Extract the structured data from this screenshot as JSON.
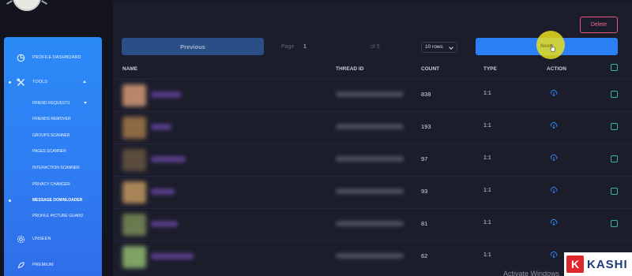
{
  "sidebar": {
    "items": [
      {
        "label": "PROFILE DASHBOARD",
        "icon": "dashboard-pie-icon"
      },
      {
        "label": "TOOLS",
        "icon": "tools-icon"
      },
      {
        "label": "UNSEEN",
        "icon": "gear-icon"
      },
      {
        "label": "PREMIUM",
        "icon": "rocket-icon"
      }
    ],
    "sub_items": [
      {
        "label": "FRIEND REQUESTS"
      },
      {
        "label": "FRIENDS REMOVER"
      },
      {
        "label": "GROUPS SCANNER"
      },
      {
        "label": "PAGES SCANNER"
      },
      {
        "label": "INTERACTION SCANNER"
      },
      {
        "label": "PRIVACY CHANGER"
      },
      {
        "label": "MESSAGE DOWNLOADER"
      },
      {
        "label": "PROFILE PICTURE GUARD"
      }
    ],
    "active_item": "MESSAGE DOWNLOADER"
  },
  "toolbar": {
    "delete_label": "Delete",
    "previous_label": "Previous",
    "page_label": "Page",
    "page_value": "1",
    "of_label": "of 5",
    "rows_value": "10 rows",
    "next_label": "Next"
  },
  "table": {
    "columns": [
      "NAME",
      "THREAD ID",
      "COUNT",
      "TYPE",
      "ACTION"
    ],
    "rows": [
      {
        "count": "838",
        "type": "1:1"
      },
      {
        "count": "193",
        "type": "1:1"
      },
      {
        "count": "97",
        "type": "1:1"
      },
      {
        "count": "93",
        "type": "1:1"
      },
      {
        "count": "81",
        "type": "1:1"
      },
      {
        "count": "62",
        "type": "1:1"
      }
    ]
  },
  "overlay": {
    "watermark_text": "Activate Windows",
    "brand_letter": "K",
    "brand_text": "KASHI"
  },
  "colors": {
    "sidebar": "#2f7cf2",
    "next_button": "#2b7ff5",
    "previous_button": "#294f86",
    "delete_border": "#e2587f",
    "checkbox": "#2fb79a",
    "background": "#1c1d2b"
  }
}
